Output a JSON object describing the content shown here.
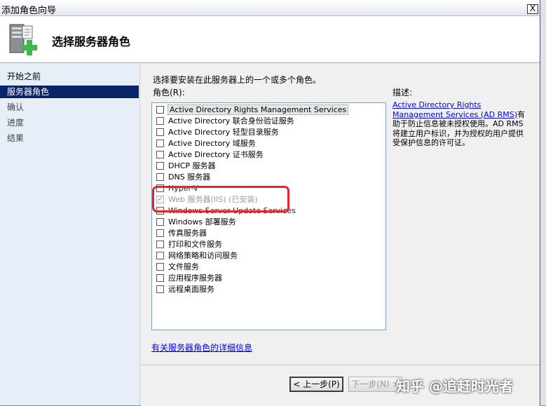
{
  "window": {
    "title": "添加角色向导",
    "close_label": "X"
  },
  "header": {
    "title": "选择服务器角色"
  },
  "nav": {
    "items": [
      {
        "label": "开始之前",
        "state": "normal"
      },
      {
        "label": "服务器角色",
        "state": "active"
      },
      {
        "label": "确认",
        "state": "disabled"
      },
      {
        "label": "进度",
        "state": "disabled"
      },
      {
        "label": "结果",
        "state": "disabled"
      }
    ]
  },
  "content": {
    "instruction": "选择要安装在此服务器上的一个或多个角色。",
    "roles_label": "角色(R):",
    "roles": [
      {
        "label": "Active Directory Rights Management Services",
        "checked": false,
        "selected": true
      },
      {
        "label": "Active Directory 联合身份验证服务",
        "checked": false
      },
      {
        "label": "Active Directory 轻型目录服务",
        "checked": false
      },
      {
        "label": "Active Directory 域服务",
        "checked": false
      },
      {
        "label": "Active Directory 证书服务",
        "checked": false
      },
      {
        "label": "DHCP 服务器",
        "checked": false
      },
      {
        "label": "DNS 服务器",
        "checked": false
      },
      {
        "label": "Hyper-V",
        "checked": false
      },
      {
        "label": "Web 服务器(IIS)  (已安装)",
        "checked": true,
        "grayed": true
      },
      {
        "label": "Windows Server Update Services",
        "checked": false
      },
      {
        "label": "Windows 部署服务",
        "checked": false
      },
      {
        "label": "传真服务器",
        "checked": false
      },
      {
        "label": "打印和文件服务",
        "checked": false
      },
      {
        "label": "网络策略和访问服务",
        "checked": false
      },
      {
        "label": "文件服务",
        "checked": false
      },
      {
        "label": "应用程序服务器",
        "checked": false
      },
      {
        "label": "远程桌面服务",
        "checked": false
      }
    ],
    "description_title": "描述:",
    "description_link": "Active Directory Rights Management Services (AD RMS)",
    "description_text": "有助于防止信息被未授权使用。AD RMS 将建立用户标识，并为授权的用户提供受保护信息的许可证。",
    "more_info_link": "有关服务器角色的详细信息"
  },
  "footer": {
    "back_label": "< 上一步(P)",
    "next_label": "下一步(N) >"
  },
  "watermark": "知乎 @追赶时光者",
  "colors": {
    "nav_active_bg": "#0a246a",
    "annotation_red": "#e8262a",
    "link": "#0000ee"
  }
}
